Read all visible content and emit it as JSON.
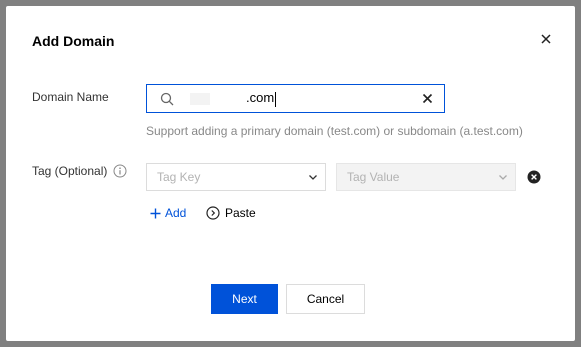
{
  "dialog": {
    "title": "Add Domain",
    "close_icon": "close-icon"
  },
  "domain": {
    "label": "Domain Name",
    "value": ".com",
    "search_icon": "search-icon",
    "clear_icon": "clear-icon",
    "helper": "Support adding a primary domain (test.com) or subdomain (a.test.com)"
  },
  "tag": {
    "label": "Tag (Optional)",
    "info_icon": "info-icon",
    "key_placeholder": "Tag Key",
    "value_placeholder": "Tag Value",
    "remove_icon": "remove-circle-icon",
    "add_label": "Add",
    "paste_label": "Paste"
  },
  "actions": {
    "next_label": "Next",
    "cancel_label": "Cancel"
  },
  "colors": {
    "primary": "#0052d9",
    "border": "#dcdcdc",
    "helper_text": "#888888"
  }
}
